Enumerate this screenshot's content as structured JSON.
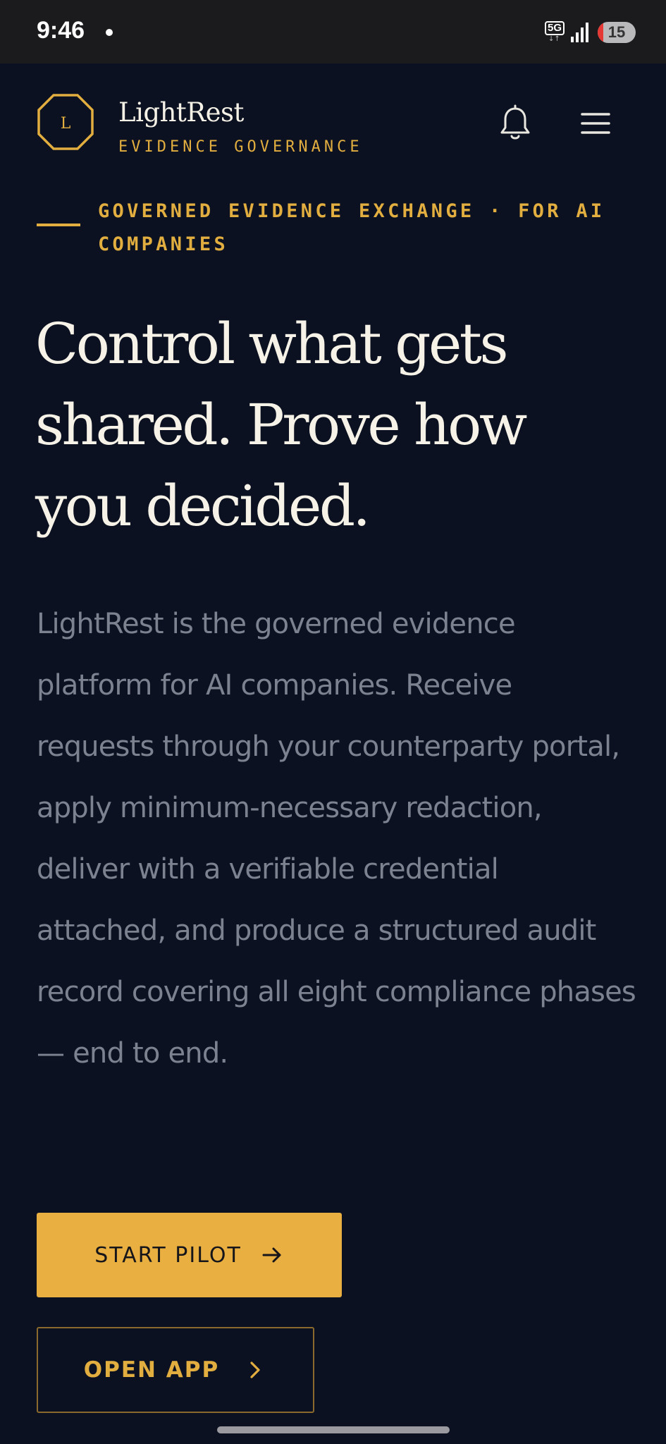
{
  "status_bar": {
    "time": "9:46",
    "network": "5G",
    "battery_level": "15",
    "battery_fraction": 0.15
  },
  "header": {
    "logo_letter": "L",
    "brand_name": "LightRest",
    "brand_tagline": "EVIDENCE GOVERNANCE"
  },
  "hero": {
    "eyebrow": "GOVERNED EVIDENCE EXCHANGE · FOR AI COMPANIES",
    "title": "Control what gets shared. Prove how you decided.",
    "body": "LightRest is the governed evidence platform for AI companies. Receive requests through your counterparty portal, apply minimum-necessary redaction, deliver with a verifiable credential attached, and produce a structured audit record covering all eight compliance phases — end to end."
  },
  "actions": {
    "primary_label": "START PILOT",
    "secondary_label": "OPEN APP"
  },
  "icons": {
    "logo": "octagon-logo-icon",
    "notifications": "bell-icon",
    "menu": "hamburger-menu-icon",
    "primary_arrow": "arrow-right-icon",
    "secondary_chevron": "chevron-right-icon"
  },
  "colors": {
    "background": "#0b1120",
    "accent": "#e2ae3f",
    "primary_button": "#e9b041",
    "title_text": "#f6f2e7",
    "body_text": "#7d8291"
  }
}
